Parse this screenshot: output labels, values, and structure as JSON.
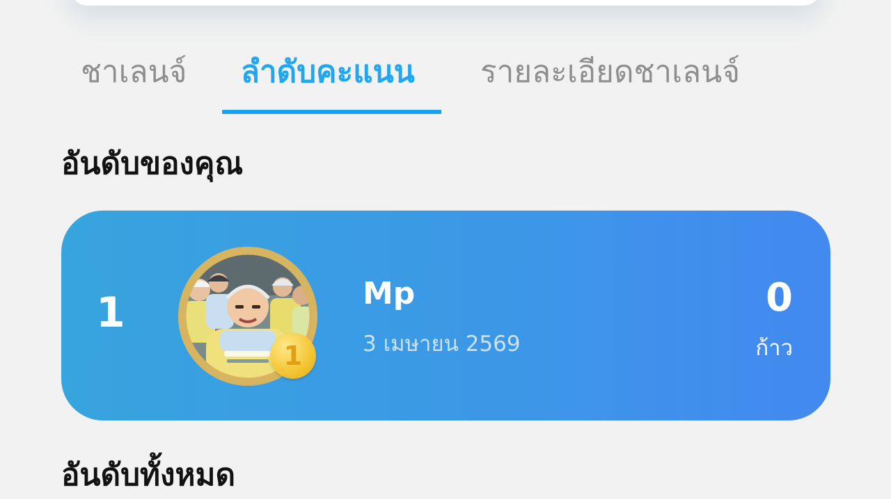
{
  "tabs": [
    {
      "label": "ชาเลนจ์",
      "active": false
    },
    {
      "label": "ลำดับคะแนน",
      "active": true
    },
    {
      "label": "รายละเอียดชาเลนจ์",
      "active": false
    }
  ],
  "sections": {
    "your_rank_title": "อันดับของคุณ",
    "all_rank_title": "อันดับทั้งหมด"
  },
  "my_rank": {
    "rank": "1",
    "medal_number": "1",
    "name": "Mp",
    "date": "3 เมษายน 2569",
    "steps": "0",
    "unit": "ก้าว"
  },
  "colors": {
    "accent": "#21a7f1",
    "card_gradient_start": "#37a4de",
    "card_gradient_end": "#4289f0",
    "medal": "#f5c83a",
    "background": "#f2f2f2"
  },
  "icons": {
    "medal": "gold-medal-icon",
    "avatar": "user-avatar-photo"
  }
}
